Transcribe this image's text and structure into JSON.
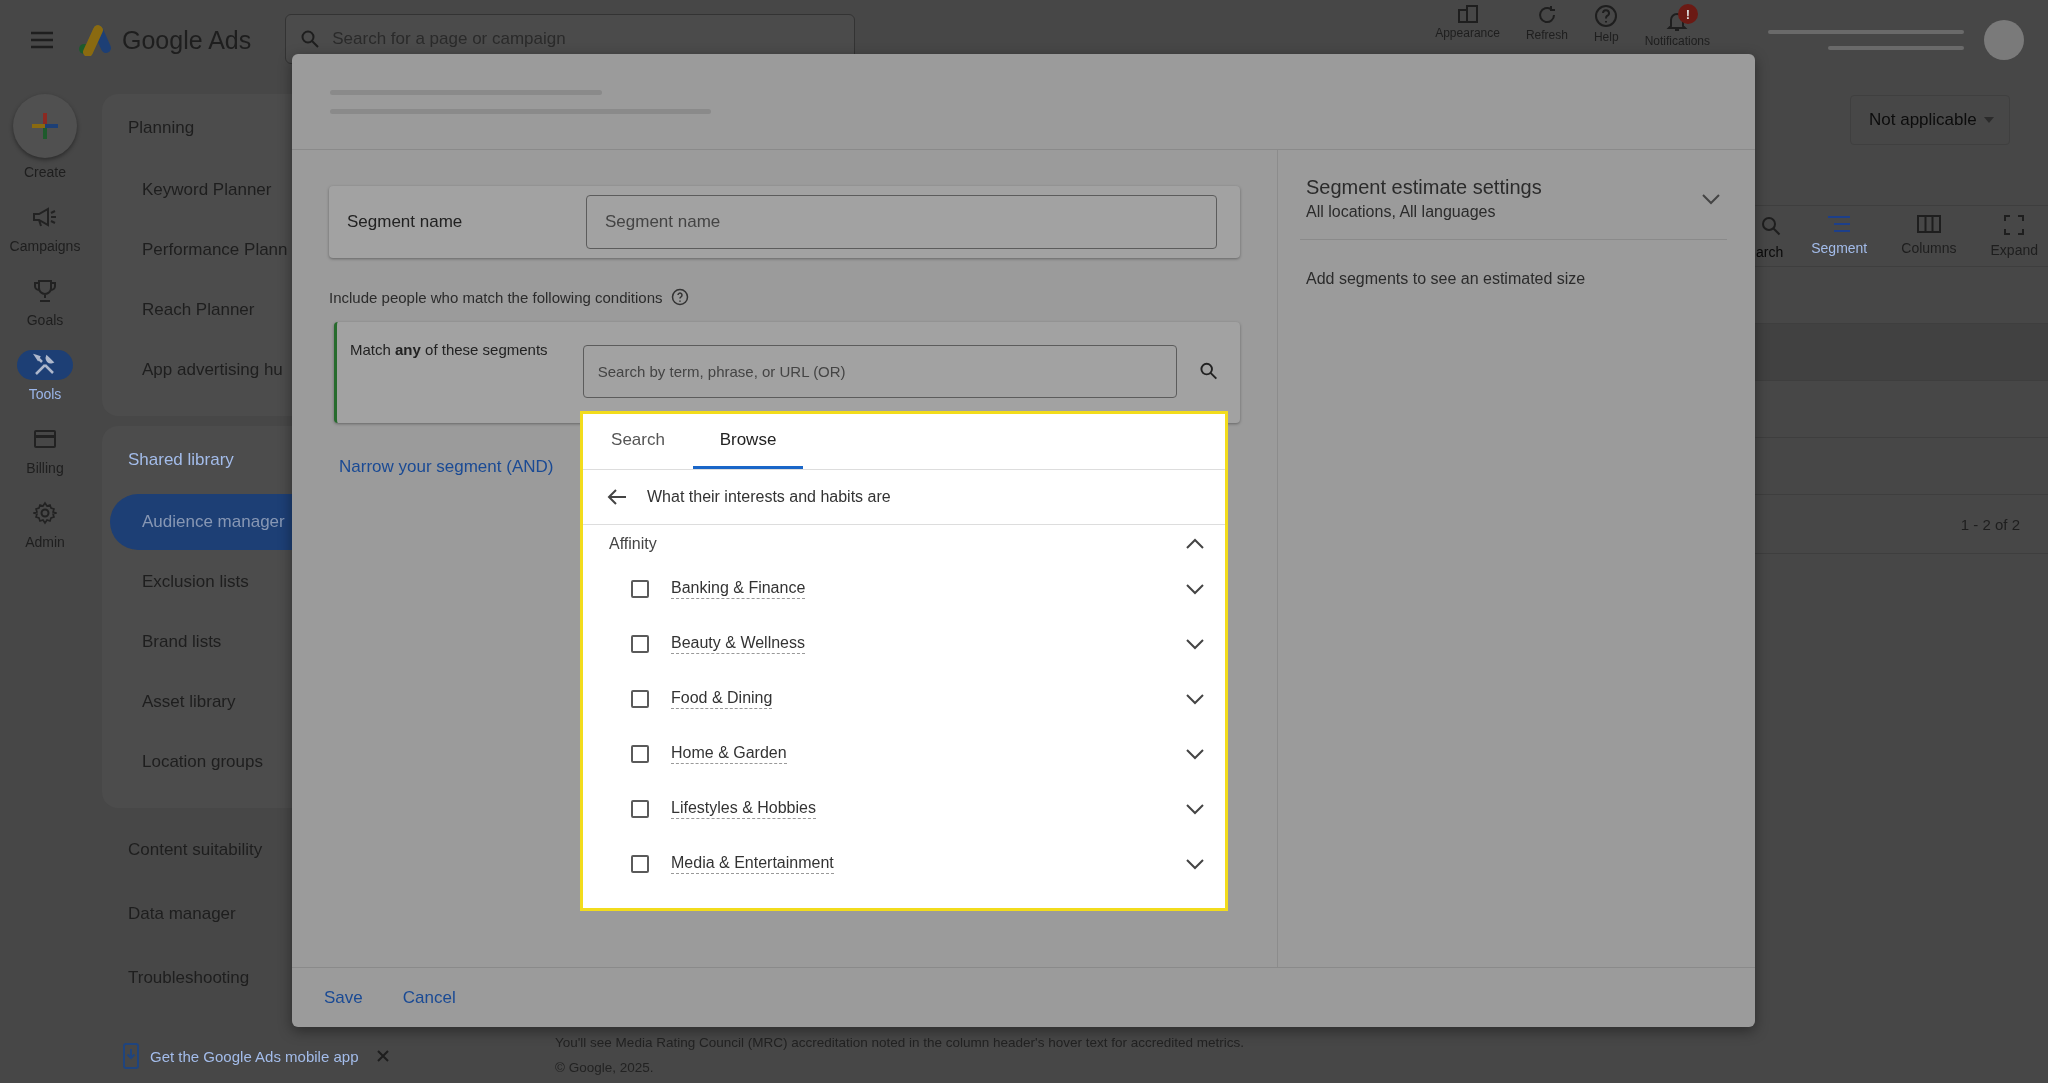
{
  "top_bar": {
    "app_name": "Google Ads",
    "search": {
      "placeholder": "Search for a page or campaign"
    },
    "actions": [
      {
        "label": "Appearance",
        "kind": "appearance"
      },
      {
        "label": "Refresh",
        "kind": "refresh"
      },
      {
        "label": "Help",
        "kind": "help"
      },
      {
        "label": "Notifications",
        "kind": "notifications",
        "badge": "!"
      }
    ]
  },
  "nav_rail": [
    {
      "label": "Create",
      "kind": "create",
      "selected": false
    },
    {
      "label": "Campaigns",
      "kind": "campaigns",
      "selected": false
    },
    {
      "label": "Goals",
      "kind": "goals",
      "selected": false
    },
    {
      "label": "Tools",
      "kind": "tools",
      "selected": true
    },
    {
      "label": "Billing",
      "kind": "billing",
      "selected": false
    },
    {
      "label": "Admin",
      "kind": "admin",
      "selected": false
    }
  ],
  "sidebar": {
    "sections": [
      {
        "title": "Planning",
        "selected": false,
        "items": [
          {
            "label": "Keyword Planner",
            "selected": false
          },
          {
            "label": "Performance Plann",
            "selected": false
          },
          {
            "label": "Reach Planner",
            "selected": false
          },
          {
            "label": "App advertising hu",
            "selected": false
          }
        ]
      },
      {
        "title": "Shared library",
        "selected": true,
        "items": [
          {
            "label": "Audience manager",
            "selected": true
          },
          {
            "label": "Exclusion lists",
            "selected": false
          },
          {
            "label": "Brand lists",
            "selected": false
          },
          {
            "label": "Asset library",
            "selected": false
          },
          {
            "label": "Location groups",
            "selected": false
          }
        ]
      },
      {
        "title": "Content suitability",
        "selected": false
      },
      {
        "title": "Data manager",
        "selected": false
      },
      {
        "title": "Troubleshooting",
        "selected": false
      }
    ],
    "mobile_app_link": "Get the Google Ads mobile app"
  },
  "main": {
    "filter": {
      "value": "Not applicable"
    },
    "toolbar": [
      {
        "label": "arch",
        "kind": "search",
        "selected": false
      },
      {
        "label": "Segment",
        "kind": "segment",
        "selected": true
      },
      {
        "label": "Columns",
        "kind": "columns",
        "selected": false
      },
      {
        "label": "Expand",
        "kind": "expand",
        "selected": false
      }
    ],
    "pagination": "1 - 2 of 2",
    "notice": "You'll see Media Rating Council (MRC) accreditation noted in the column header's hover text for accredited metrics.",
    "copyright": "© Google, 2025."
  },
  "dialog": {
    "segment_name": {
      "label": "Segment name",
      "placeholder": "Segment name"
    },
    "conditions_label": "Include people who match the following conditions",
    "match": {
      "text": "Match **any** of these segments",
      "search": {
        "placeholder": "Search by term, phrase, or URL (OR)"
      }
    },
    "narrow_link": "Narrow your segment (AND)",
    "browse_panel": {
      "tabs": [
        {
          "label": "Search",
          "selected": false
        },
        {
          "label": "Browse",
          "selected": true
        }
      ],
      "path": "What their interests and habits are",
      "group": {
        "label": "Affinity",
        "expanded": true,
        "children": [
          {
            "label": "Banking & Finance",
            "checked": false,
            "expanded": false
          },
          {
            "label": "Beauty & Wellness",
            "checked": false,
            "expanded": false
          },
          {
            "label": "Food & Dining",
            "checked": false,
            "expanded": false
          },
          {
            "label": "Home & Garden",
            "checked": false,
            "expanded": false
          },
          {
            "label": "Lifestyles & Hobbies",
            "checked": false,
            "expanded": false
          },
          {
            "label": "Media & Entertainment",
            "checked": false,
            "expanded": false
          }
        ]
      }
    },
    "estimate": {
      "title": "Segment estimate settings",
      "subtitle": "All locations, All languages",
      "expanded": false,
      "message": "Add segments to see an estimated size"
    },
    "buttons": [
      {
        "label": "Save"
      },
      {
        "label": "Cancel"
      }
    ]
  }
}
